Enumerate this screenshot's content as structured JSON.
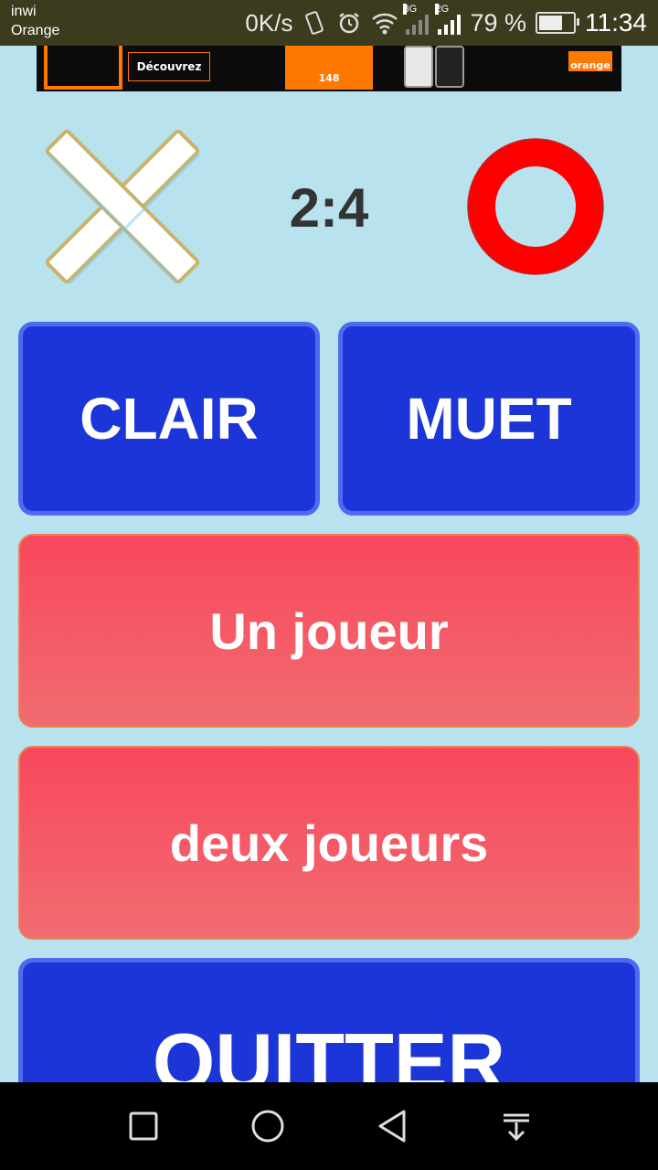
{
  "status_bar": {
    "carrier_line1": "inwi",
    "carrier_line2": "Orange",
    "net_speed": "0K/s",
    "sim1_label": "3G",
    "sim2_label": "2G",
    "battery": "79 %",
    "battery_level": 0.79,
    "time": "11:34"
  },
  "ad_banner": {
    "cta": "Découvrez",
    "promo_price": "148",
    "brand": "orange"
  },
  "game": {
    "player_x_icon": "x-mark-icon",
    "score": "2:4",
    "player_o_icon": "o-ring-icon"
  },
  "buttons": {
    "clair": "CLAIR",
    "muet": "MUET",
    "un_joueur": "Un joueur",
    "deux_joueurs": "deux joueurs",
    "quitter": "QUITTER"
  },
  "colors": {
    "background": "#b9e2ef",
    "blue_button": "#1c35d8",
    "red_button": "#f9485c",
    "o_ring": "#ff0000"
  },
  "nav_bar": {
    "icons": [
      "recent-apps-icon",
      "home-icon",
      "back-icon",
      "notification-drawer-icon"
    ]
  }
}
